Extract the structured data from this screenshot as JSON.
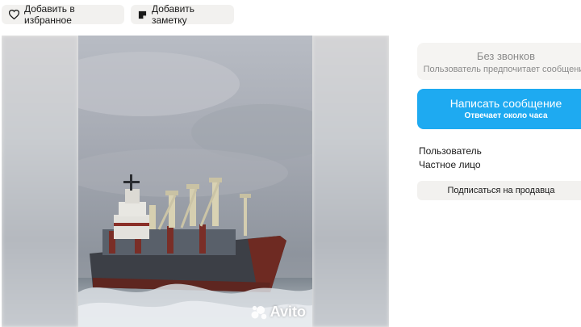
{
  "top_actions": {
    "favorite_label": "Добавить в избранное",
    "note_label": "Добавить заметку"
  },
  "gallery": {
    "watermark": "Avito"
  },
  "contact": {
    "calls_title": "Без звонков",
    "calls_subtitle": "Пользователь предпочитает сообщения",
    "write_button_label": "Написать сообщение",
    "write_button_sub": "Отвечает около часа"
  },
  "seller": {
    "role": "Пользователь",
    "type": "Частное лицо",
    "subscribe_label": "Подписаться на продавца"
  },
  "colors": {
    "accent": "#1eaaf1",
    "pill_bg": "#f2f1ef"
  }
}
